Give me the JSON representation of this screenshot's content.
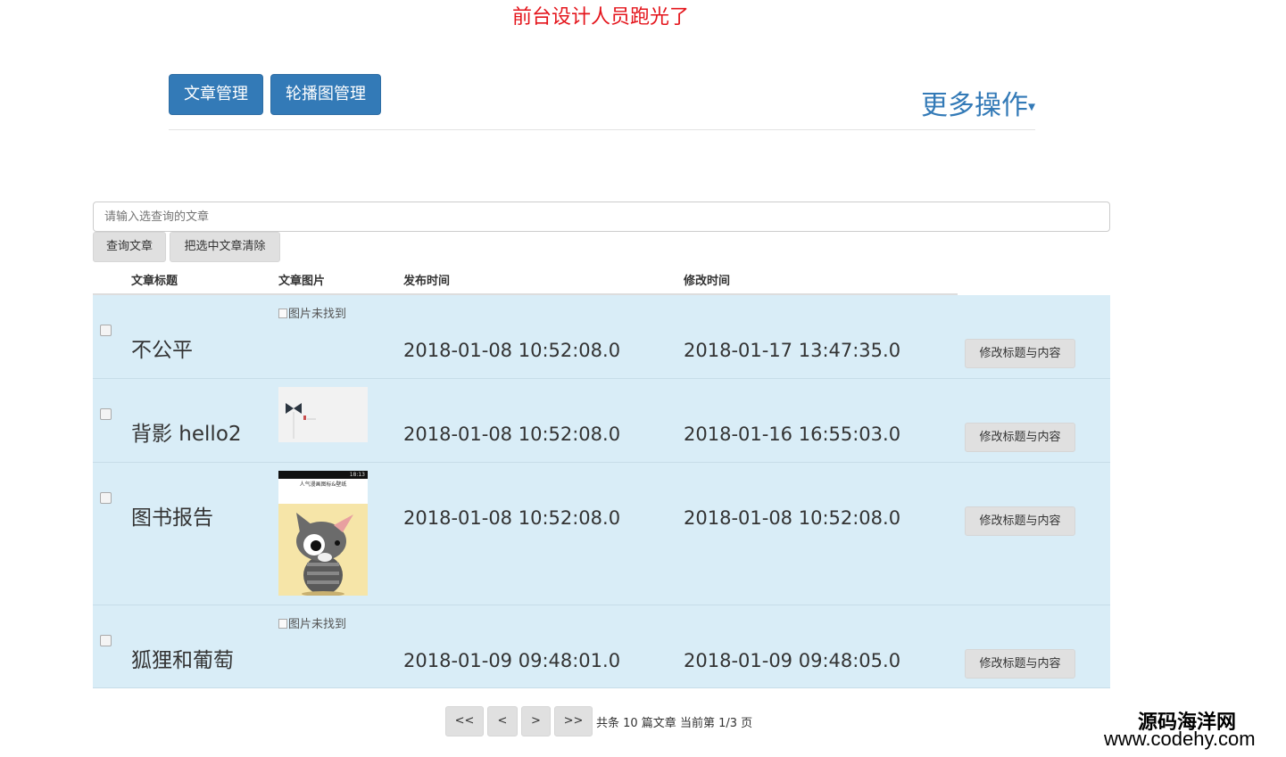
{
  "banner": "前台设计人员跑光了",
  "nav": {
    "article_btn": "文章管理",
    "carousel_btn": "轮播图管理",
    "more": "更多操作",
    "more_caret": "▾"
  },
  "search": {
    "placeholder": "请输入选查询的文章"
  },
  "actions": {
    "query": "查询文章",
    "clear": "把选中文章清除"
  },
  "table": {
    "headers": [
      "文章标题",
      "文章图片",
      "发布时间",
      "修改时间"
    ],
    "broken_image_text": "图片未找到",
    "edit_label": "修改标题与内容",
    "rows": [
      {
        "title": "不公平",
        "image": "broken",
        "published": "2018-01-08 10:52:08.0",
        "modified": "2018-01-17 13:47:35.0"
      },
      {
        "title": "背影 hello2",
        "image": "bowtie-sketch",
        "published": "2018-01-08 10:52:08.0",
        "modified": "2018-01-16 16:55:03.0"
      },
      {
        "title": "图书报告",
        "image": "cat-app-screenshot",
        "published": "2018-01-08 10:52:08.0",
        "modified": "2018-01-08 10:52:08.0"
      },
      {
        "title": "狐狸和葡萄",
        "image": "broken",
        "published": "2018-01-09 09:48:01.0",
        "modified": "2018-01-09 09:48:05.0"
      }
    ]
  },
  "thumb_text": {
    "status_time": "18:13",
    "app_title": "人气漫画图标&壁纸"
  },
  "pagination": {
    "first": "<<",
    "prev": "<",
    "next": ">",
    "last": ">>",
    "info": "共条 10 篇文章 当前第 1/3 页"
  },
  "watermark": {
    "name": "源码海洋网",
    "url": "www.codehy.com"
  },
  "colors": {
    "primary": "#337ab7",
    "banner": "#e4141b",
    "row_bg": "#d9edf7",
    "button_bg": "#e0e0e0"
  }
}
